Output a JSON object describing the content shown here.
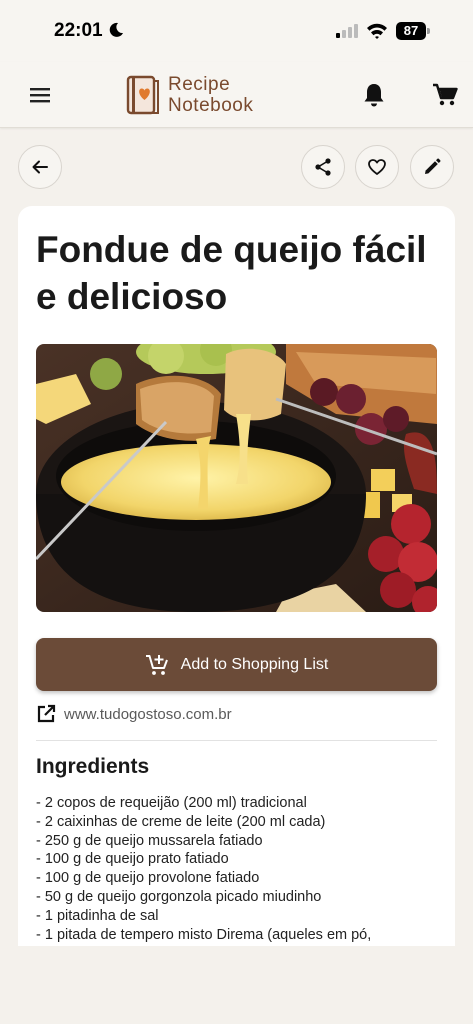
{
  "status_bar": {
    "time": "22:01",
    "battery": "87"
  },
  "app_bar": {
    "brand_line1": "Recipe",
    "brand_line2": "Notebook"
  },
  "recipe": {
    "title": "Fondue de queijo fácil e delicioso",
    "add_to_list_label": "Add to Shopping List",
    "source": "www.tudogostoso.com.br",
    "ingredients_heading": "Ingredients",
    "ingredients": [
      "- 2 copos de requeijão (200 ml) tradicional",
      "- 2 caixinhas de creme de leite (200 ml cada)",
      "- 250 g de queijo mussarela fatiado",
      "- 100 g de queijo prato fatiado",
      "- 100 g de queijo provolone fatiado",
      "- 50 g de queijo gorgonzola picado miudinho",
      "- 1 pitadinha de sal",
      "- 1 pitada de tempero misto Direma (aqueles em pó,"
    ]
  },
  "colors": {
    "accent": "#6b4b38",
    "brand": "#7a4a2e",
    "background": "#f4f1ec"
  },
  "icons": [
    "moon-icon",
    "signal-icon",
    "wifi-icon",
    "menu-icon",
    "recipe-book-logo",
    "bell-icon",
    "cart-icon",
    "back-arrow-icon",
    "share-icon",
    "heart-icon",
    "edit-icon",
    "add-cart-icon",
    "external-link-icon"
  ]
}
